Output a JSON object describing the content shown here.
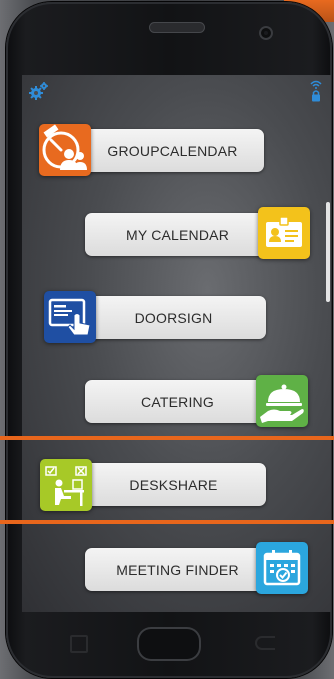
{
  "menu": {
    "items": [
      {
        "label": "GROUPCALENDAR",
        "icon": "group-calendar-icon",
        "color": "#e86a1f"
      },
      {
        "label": "MY CALENDAR",
        "icon": "id-card-icon",
        "color": "#f3c21b"
      },
      {
        "label": "DOORSIGN",
        "icon": "touchscreen-icon",
        "color": "#1f4fa3"
      },
      {
        "label": "CATERING",
        "icon": "cloche-icon",
        "color": "#5fb146"
      },
      {
        "label": "DESKSHARE",
        "icon": "desk-worker-icon",
        "color": "#a7c927"
      },
      {
        "label": "MEETING FINDER",
        "icon": "calendar-check-icon",
        "color": "#2ba6de"
      }
    ]
  },
  "statusbar": {
    "left_icon": "gear-icon",
    "right_icon": "wifi-lock-icon"
  },
  "colors": {
    "highlight": "#e8661c",
    "status_icon": "#2f8cd8"
  }
}
